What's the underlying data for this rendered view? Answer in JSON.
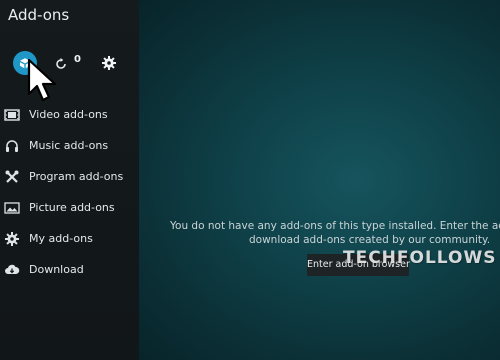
{
  "app": {
    "title": "Add-ons"
  },
  "topbar": {
    "primary_icon": "open-box-icon",
    "refresh_icon": "refresh-icon",
    "update_count": "0",
    "settings_icon": "gear-icon",
    "accent_color": "#1f98c7"
  },
  "sidebar": {
    "items": [
      {
        "label": "Video add-ons",
        "icon": "film-icon"
      },
      {
        "label": "Music add-ons",
        "icon": "headphones-icon"
      },
      {
        "label": "Program add-ons",
        "icon": "tools-icon"
      },
      {
        "label": "Picture add-ons",
        "icon": "picture-icon"
      },
      {
        "label": "My add-ons",
        "icon": "gear-icon"
      },
      {
        "label": "Download",
        "icon": "cloud-download-icon"
      }
    ]
  },
  "main": {
    "message_line1": "You do not have any add-ons of this type installed. Enter the add-on b",
    "message_line2": "download add-ons created by our community.",
    "browser_button_label": "Enter add-on browser",
    "watermark": "TECHFOLLOWS"
  },
  "cursor": {
    "icon": "mouse-pointer-icon"
  }
}
